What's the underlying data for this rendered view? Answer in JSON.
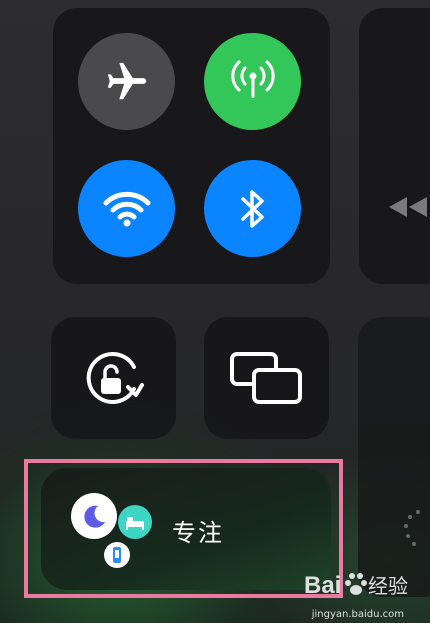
{
  "control_center": {
    "connectivity": {
      "airplane": {
        "icon": "airplane-icon",
        "state": "off",
        "color": "#4a4a4d"
      },
      "cellular": {
        "icon": "antenna-icon",
        "state": "on",
        "color": "#33c759"
      },
      "wifi": {
        "icon": "wifi-icon",
        "state": "on",
        "color": "#0a84ff"
      },
      "bluetooth": {
        "icon": "bluetooth-icon",
        "state": "on",
        "color": "#0a84ff"
      }
    },
    "orientation_lock": {
      "icon": "rotation-lock-icon"
    },
    "screen_mirroring": {
      "icon": "screen-mirroring-icon"
    },
    "media": {
      "icon": "rewind-icon"
    },
    "brightness": {
      "icon": "sun-icon"
    },
    "focus": {
      "label": "专注",
      "icons": [
        "moon-icon",
        "bed-icon",
        "phone-icon"
      ],
      "bed_color": "#3fd5c4"
    }
  },
  "annotation": {
    "highlight_color": "#ea7aa2"
  },
  "watermark": {
    "logo_text": "Bai 经验",
    "url": "jingyan.baidu.com"
  }
}
